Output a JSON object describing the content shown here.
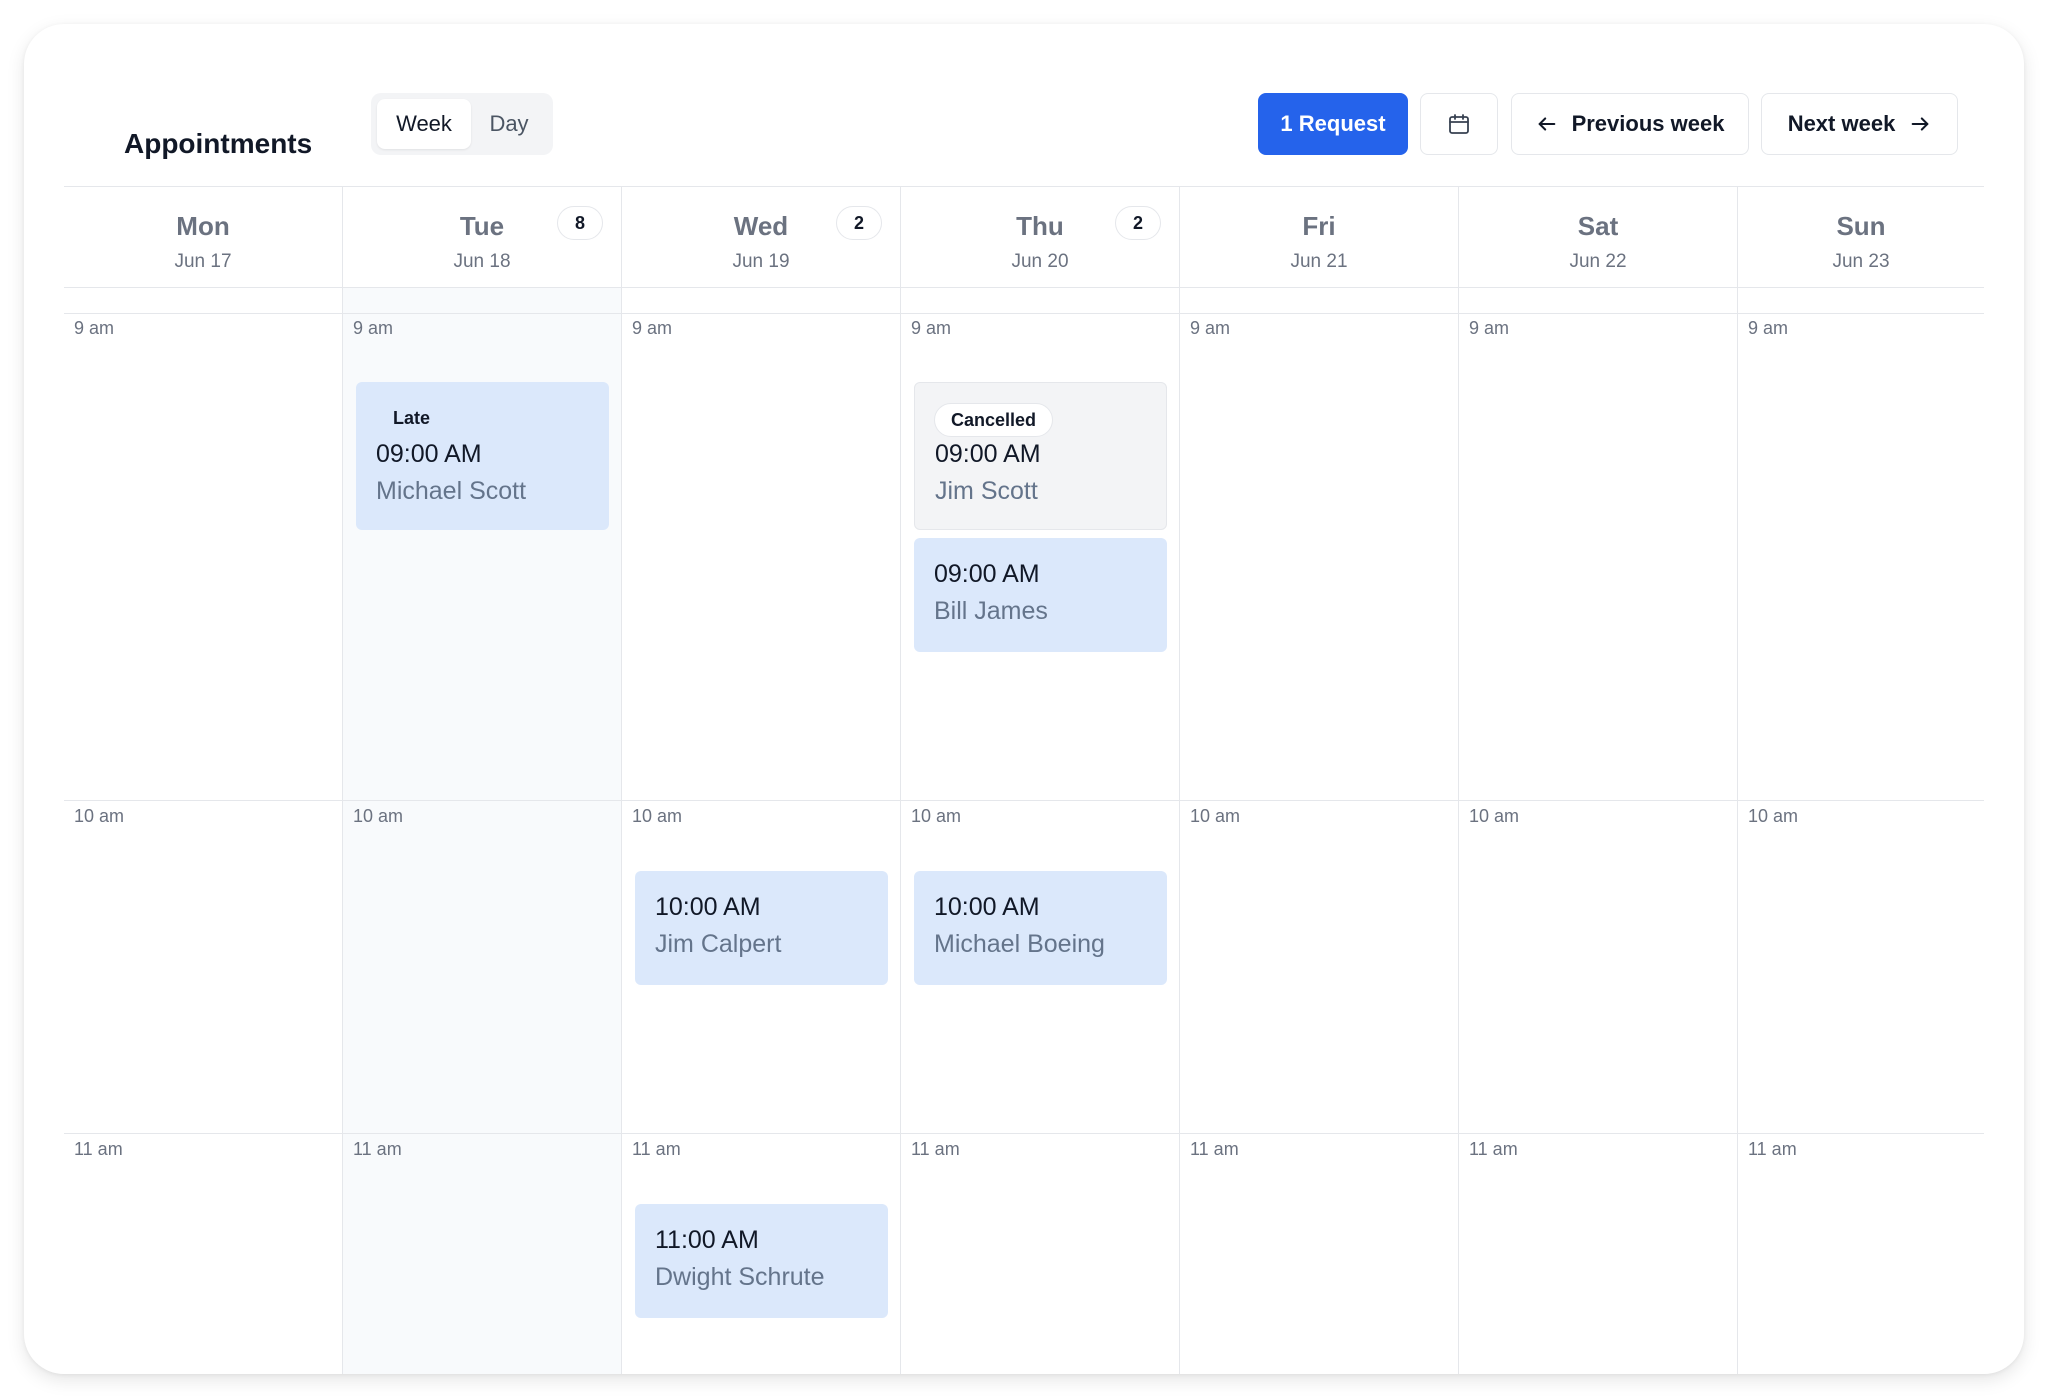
{
  "header": {
    "title": "Appointments",
    "view_week": "Week",
    "view_day": "Day",
    "active_view": "Week",
    "request_label": "1 Request",
    "calendar_icon": "calendar-icon",
    "prev_label": "Previous week",
    "next_label": "Next week",
    "accent_color": "#2563eb"
  },
  "days": [
    {
      "name": "Mon",
      "date": "Jun 17",
      "count": null
    },
    {
      "name": "Tue",
      "date": "Jun 18",
      "count": "8"
    },
    {
      "name": "Wed",
      "date": "Jun 19",
      "count": "2"
    },
    {
      "name": "Thu",
      "date": "Jun 20",
      "count": "2"
    },
    {
      "name": "Fri",
      "date": "Jun 21",
      "count": null
    },
    {
      "name": "Sat",
      "date": "Jun 22",
      "count": null
    },
    {
      "name": "Sun",
      "date": "Jun 23",
      "count": null
    }
  ],
  "hours": [
    "9 am",
    "10 am",
    "11 am"
  ],
  "appointments": {
    "tue_9": {
      "tag": "Late",
      "time": "09:00 AM",
      "name": "Michael Scott"
    },
    "thu_9a": {
      "tag": "Cancelled",
      "time": "09:00 AM",
      "name": "Jim Scott"
    },
    "thu_9b": {
      "time": "09:00 AM",
      "name": "Bill James"
    },
    "wed_10": {
      "time": "10:00 AM",
      "name": "Jim Calpert"
    },
    "thu_10": {
      "time": "10:00 AM",
      "name": "Michael Boeing"
    },
    "wed_11": {
      "time": "11:00 AM",
      "name": "Dwight Schrute"
    }
  }
}
